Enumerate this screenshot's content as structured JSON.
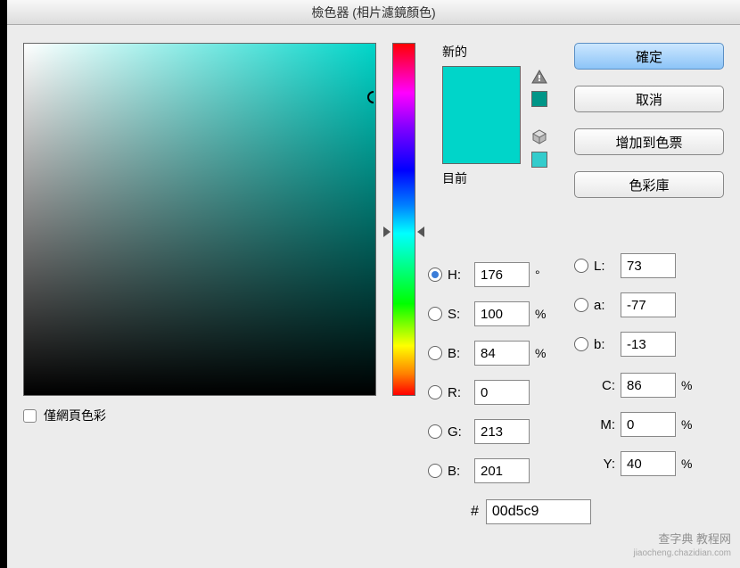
{
  "title": "檢色器 (相片濾鏡顏色)",
  "swatch": {
    "new_label": "新的",
    "current_label": "目前",
    "hex": "#00d5c9"
  },
  "websafe": {
    "label": "僅網頁色彩"
  },
  "buttons": {
    "ok": "確定",
    "cancel": "取消",
    "add": "增加到色票",
    "lib": "色彩庫"
  },
  "hsb": {
    "h": {
      "label": "H:",
      "value": "176",
      "unit": "°"
    },
    "s": {
      "label": "S:",
      "value": "100",
      "unit": "%"
    },
    "b": {
      "label": "B:",
      "value": "84",
      "unit": "%"
    }
  },
  "rgb": {
    "r": {
      "label": "R:",
      "value": "0"
    },
    "g": {
      "label": "G:",
      "value": "213"
    },
    "b": {
      "label": "B:",
      "value": "201"
    }
  },
  "lab": {
    "l": {
      "label": "L:",
      "value": "73"
    },
    "a": {
      "label": "a:",
      "value": "-77"
    },
    "b": {
      "label": "b:",
      "value": "-13"
    }
  },
  "cmyk": {
    "c": {
      "label": "C:",
      "value": "86",
      "unit": "%"
    },
    "m": {
      "label": "M:",
      "value": "0",
      "unit": "%"
    },
    "y": {
      "label": "Y:",
      "value": "40",
      "unit": "%"
    }
  },
  "hex": {
    "value": "00d5c9"
  },
  "watermark": {
    "main": "查字典 教程网",
    "sub": "jiaocheng.chazidian.com"
  }
}
